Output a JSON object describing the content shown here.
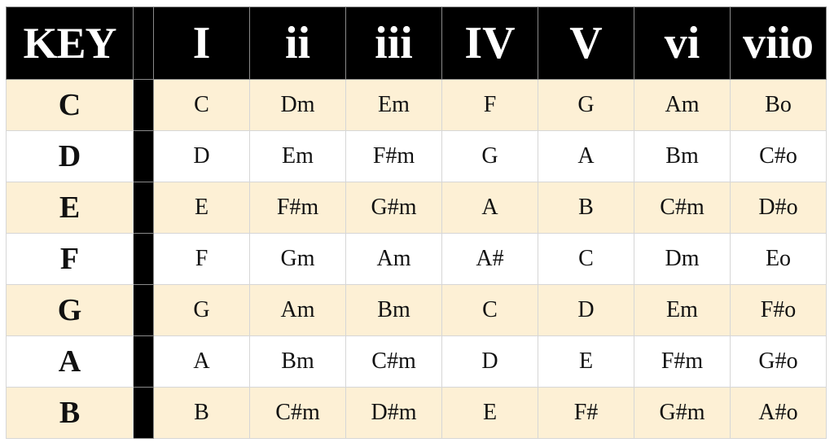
{
  "table": {
    "headers": [
      "KEY",
      "I",
      "ii",
      "iii",
      "IV",
      "V",
      "vi",
      "viio"
    ],
    "rows": [
      {
        "key": "C",
        "chords": [
          "C",
          "Dm",
          "Em",
          "F",
          "G",
          "Am",
          "Bo"
        ]
      },
      {
        "key": "D",
        "chords": [
          "D",
          "Em",
          "F#m",
          "G",
          "A",
          "Bm",
          "C#o"
        ]
      },
      {
        "key": "E",
        "chords": [
          "E",
          "F#m",
          "G#m",
          "A",
          "B",
          "C#m",
          "D#o"
        ]
      },
      {
        "key": "F",
        "chords": [
          "F",
          "Gm",
          "Am",
          "A#",
          "C",
          "Dm",
          "Eo"
        ]
      },
      {
        "key": "G",
        "chords": [
          "G",
          "Am",
          "Bm",
          "C",
          "D",
          "Em",
          "F#o"
        ]
      },
      {
        "key": "A",
        "chords": [
          "A",
          "Bm",
          "C#m",
          "D",
          "E",
          "F#m",
          "G#o"
        ]
      },
      {
        "key": "B",
        "chords": [
          "B",
          "C#m",
          "D#m",
          "E",
          "F#",
          "G#m",
          "A#o"
        ]
      }
    ]
  },
  "colors": {
    "header_bg": "#000000",
    "header_text": "#ffffff",
    "row_highlight": "#fdf0d5",
    "row_plain": "#ffffff"
  }
}
